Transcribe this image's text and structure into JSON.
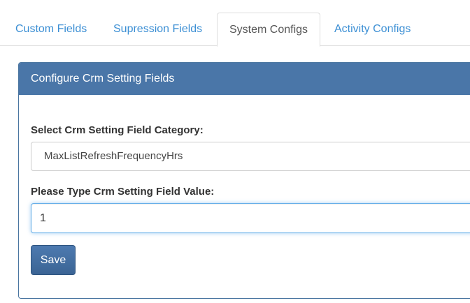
{
  "tabs": [
    {
      "label": "Custom Fields",
      "active": false
    },
    {
      "label": "Supression Fields",
      "active": false
    },
    {
      "label": "System Configs",
      "active": true
    },
    {
      "label": "Activity Configs",
      "active": false
    }
  ],
  "panel": {
    "title": "Configure Crm Setting Fields",
    "category_label": "Select Crm Setting Field Category:",
    "category_selected": "MaxListRefreshFrequencyHrs",
    "value_label": "Please Type Crm Setting Field Value:",
    "value": "1",
    "save_label": "Save"
  },
  "colors": {
    "tab_link": "#3c8fd4",
    "panel_heading": "#4a76a8",
    "button": "#3f6a9c",
    "input_focus": "#66afe9"
  }
}
